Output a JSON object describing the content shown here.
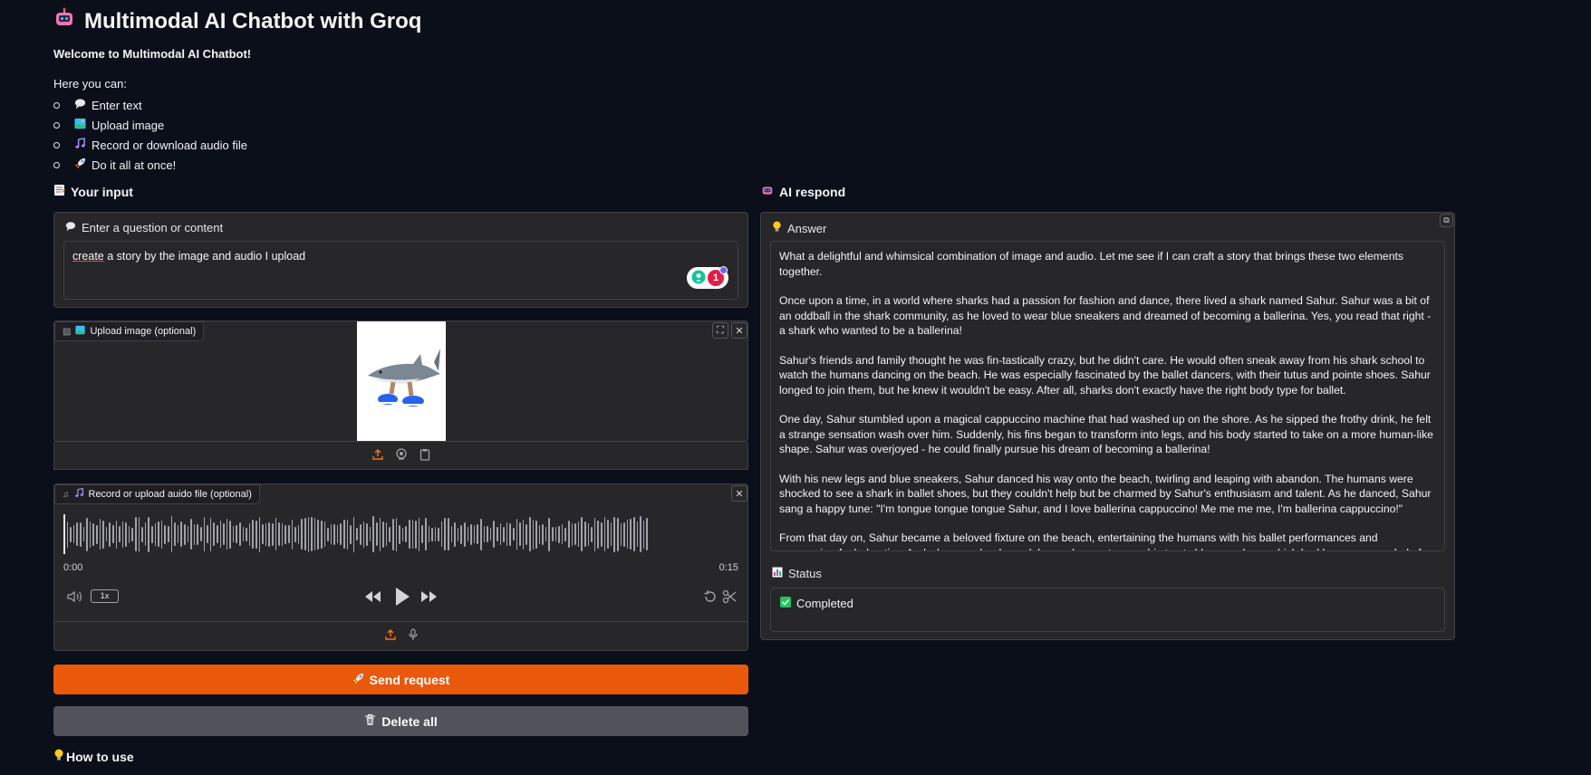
{
  "header": {
    "icon": "robot-icon",
    "title": "Multimodal AI Chatbot with Groq"
  },
  "welcome": "Welcome to Multimodal AI Chatbot!",
  "intro": "Here you can:",
  "features": [
    {
      "icon": "speech-bubble-icon",
      "label": "Enter text"
    },
    {
      "icon": "picture-icon",
      "label": "Upload image"
    },
    {
      "icon": "music-note-icon",
      "label": "Record or download audio file"
    },
    {
      "icon": "rocket-icon",
      "label": "Do it all at once!"
    }
  ],
  "input_section": {
    "title": "Your input",
    "question_label": "Enter a question or content",
    "question_value_first": "create",
    "question_value_rest": " a story by the image and audio I upload",
    "grammarly_badge": "1"
  },
  "image_upload": {
    "label": "Upload image (optional)"
  },
  "audio_upload": {
    "label": "Record or upload auido file (optional)",
    "time_start": "0:00",
    "time_end": "0:15",
    "speed": "1x"
  },
  "buttons": {
    "send": "Send request",
    "delete": "Delete all"
  },
  "how_to_use": "How to use",
  "output_section": {
    "title": "AI respond",
    "answer_label": "Answer",
    "answer_paragraphs": [
      "What a delightful and whimsical combination of image and audio. Let me see if I can craft a story that brings these two elements together.",
      "Once upon a time, in a world where sharks had a passion for fashion and dance, there lived a shark named Sahur. Sahur was a bit of an oddball in the shark community, as he loved to wear blue sneakers and dreamed of becoming a ballerina. Yes, you read that right - a shark who wanted to be a ballerina!",
      "Sahur's friends and family thought he was fin-tastically crazy, but he didn't care. He would often sneak away from his shark school to watch the humans dancing on the beach. He was especially fascinated by the ballet dancers, with their tutus and pointe shoes. Sahur longed to join them, but he knew it wouldn't be easy. After all, sharks don't exactly have the right body type for ballet.",
      "One day, Sahur stumbled upon a magical cappuccino machine that had washed up on the shore. As he sipped the frothy drink, he felt a strange sensation wash over him. Suddenly, his fins began to transform into legs, and his body started to take on a more human-like shape. Sahur was overjoyed - he could finally pursue his dream of becoming a ballerina!",
      "With his new legs and blue sneakers, Sahur danced his way onto the beach, twirling and leaping with abandon. The humans were shocked to see a shark in ballet shoes, but they couldn't help but be charmed by Sahur's enthusiasm and talent. As he danced, Sahur sang a happy tune: \"I'm tongue tongue tongue Sahur, and I love ballerina cappuccino! Me me me me, I'm ballerina cappuccino!\"",
      "From that day on, Sahur became a beloved fixture on the beach, entertaining the humans with his ballet performances and cappuccino-fueled antics. And whenever he danced, he made sure to wear his trusty blue sneakers, which had become a symbol of his unique spirit and creativity."
    ],
    "status_label": "Status",
    "status_value": "Completed"
  }
}
